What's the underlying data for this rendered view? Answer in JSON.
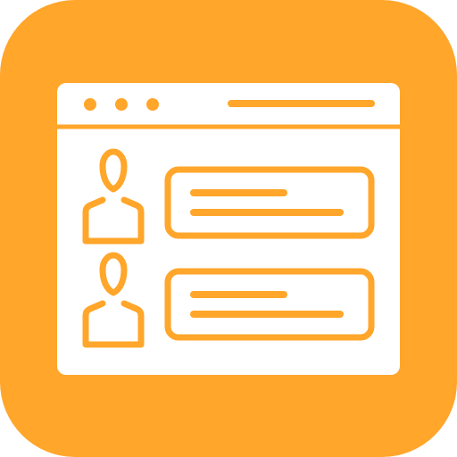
{
  "icon": {
    "semantic": "chat-window-users-icon",
    "colors": {
      "background": "#FFA62B",
      "window": "#FFFFFF"
    },
    "window": {
      "dots_count": 3
    },
    "messages": [
      {
        "user_icon": "user-icon",
        "text_lines": 2
      },
      {
        "user_icon": "user-icon",
        "text_lines": 2
      }
    ]
  }
}
